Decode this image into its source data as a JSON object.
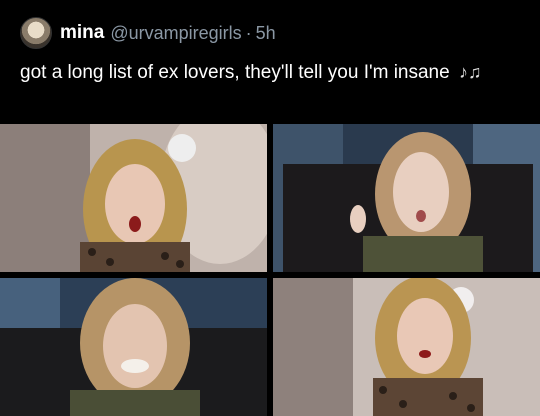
{
  "tweet": {
    "display_name": "mina",
    "handle": "@urvampiregirls",
    "separator": "·",
    "time": "5h",
    "text": "got a long list of ex lovers, they'll tell you I'm insane",
    "emoji_icon": "music-notes-icon",
    "emoji_glyph": "♪♫"
  },
  "images": [
    {
      "name": "photo-top-left"
    },
    {
      "name": "photo-top-right"
    },
    {
      "name": "photo-bottom-left"
    },
    {
      "name": "photo-bottom-right"
    }
  ],
  "colors": {
    "background": "#000000",
    "text": "#ffffff",
    "muted": "#8b98a5"
  }
}
